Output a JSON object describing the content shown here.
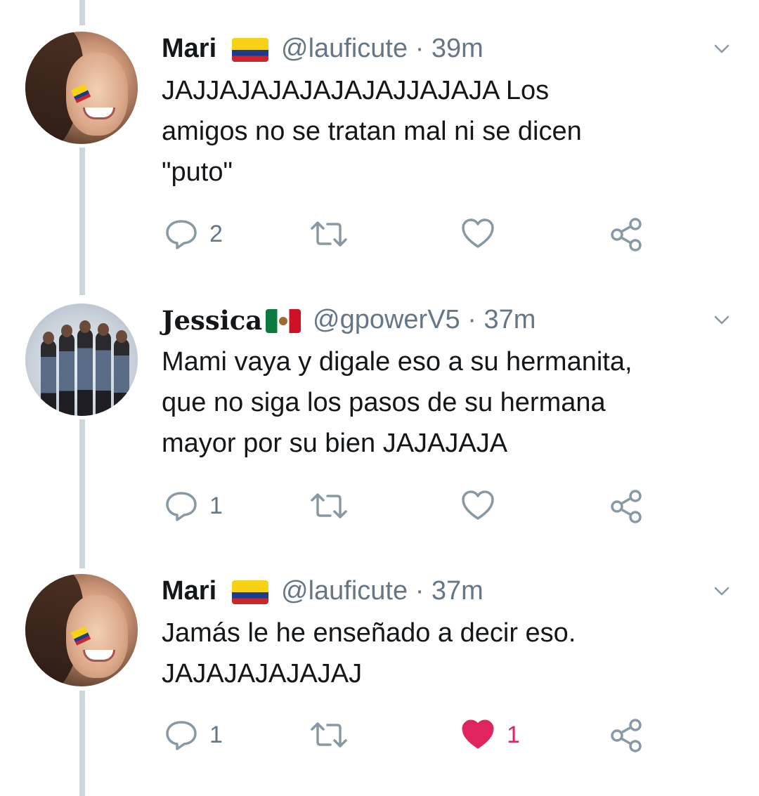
{
  "tweets": [
    {
      "name": "Mari",
      "flag": "colombia-flag",
      "handle": "@lauficute",
      "separator": "·",
      "time": "39m",
      "text_lines": [
        "JAJJAJAJAJAJAJAJJAJAJA Los",
        "amigos no se tratan mal ni se dicen",
        "\"puto\""
      ],
      "replies": "2",
      "retweets": "",
      "likes": "",
      "liked": false
    },
    {
      "name": "Jessica",
      "flag": "mexico-flag",
      "handle": "@gpowerV5",
      "separator": "·",
      "time": "37m",
      "text_lines": [
        "Mami vaya y digale eso a su hermanita,",
        "que no siga los pasos de su hermana",
        "mayor por su bien JAJAJAJA"
      ],
      "replies": "1",
      "retweets": "",
      "likes": "",
      "liked": false
    },
    {
      "name": "Mari",
      "flag": "colombia-flag",
      "handle": "@lauficute",
      "separator": "·",
      "time": "37m",
      "text_lines": [
        "Jamás le he enseñado a decir eso.",
        "JAJAJAJAJAJAJ"
      ],
      "replies": "1",
      "retweets": "",
      "likes": "1",
      "liked": true
    }
  ],
  "colors": {
    "text": "#14171a",
    "secondary": "#657786",
    "like_active": "#e0245e",
    "thread_line": "#ccd6dd"
  },
  "icons": [
    "reply-icon",
    "retweet-icon",
    "like-icon",
    "share-icon",
    "chevron-down-icon"
  ]
}
